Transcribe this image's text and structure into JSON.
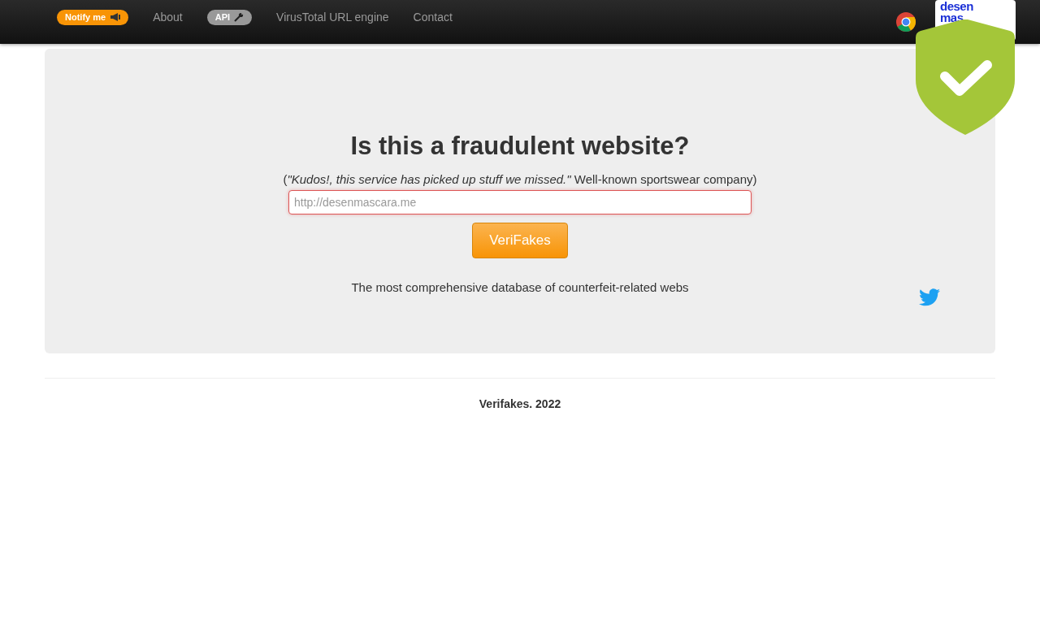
{
  "navbar": {
    "items": [
      {
        "label": "Notify me",
        "kind": "notify"
      },
      {
        "label": "About",
        "kind": "link"
      },
      {
        "label": "API",
        "kind": "api"
      },
      {
        "label": "VirusTotal URL engine",
        "kind": "link"
      },
      {
        "label": "Contact",
        "kind": "link"
      }
    ],
    "logo_lines": [
      "desen",
      "mas"
    ]
  },
  "hero": {
    "title": "Is this a fraudulent website?",
    "quote": "(*\"Kudos!, this service has picked up stuff we missed.\"* Well-known sportswear company)",
    "url_field": {
      "placeholder": "http://desenmascara.me"
    },
    "button": "VeriFakes",
    "tagline": "The most comprehensive database of counterfeit-related webs"
  },
  "footer": {
    "text": "Verifakes. 2022"
  }
}
